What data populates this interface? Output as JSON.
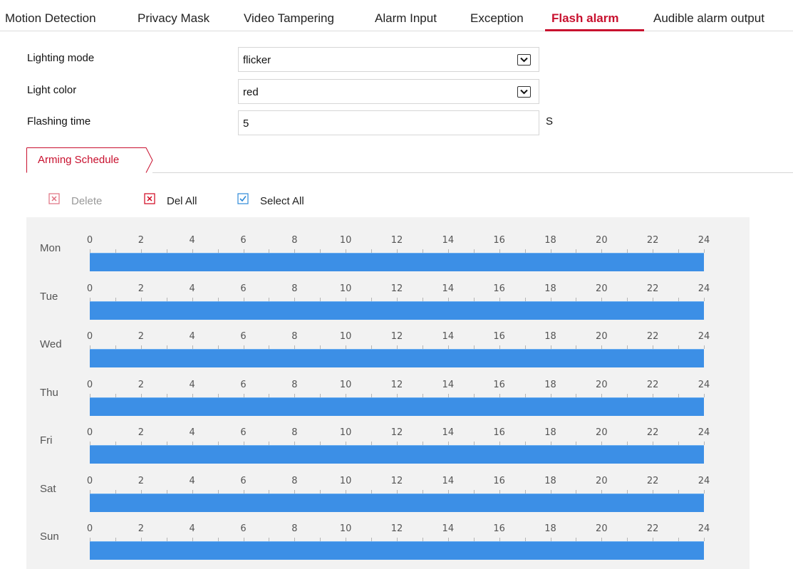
{
  "tabs": [
    {
      "label": "Motion Detection",
      "active": false
    },
    {
      "label": "Privacy Mask",
      "active": false
    },
    {
      "label": "Video Tampering",
      "active": false
    },
    {
      "label": "Alarm Input",
      "active": false
    },
    {
      "label": "Exception",
      "active": false
    },
    {
      "label": "Flash alarm",
      "active": true
    },
    {
      "label": "Audible alarm output",
      "active": false
    }
  ],
  "form": {
    "lighting_mode": {
      "label": "Lighting mode",
      "value": "flicker"
    },
    "light_color": {
      "label": "Light color",
      "value": "red"
    },
    "flashing_time": {
      "label": "Flashing time",
      "value": "5",
      "unit": "S"
    }
  },
  "schedule": {
    "tab_label": "Arming Schedule",
    "toolbar": {
      "delete_label": "Delete",
      "del_all_label": "Del All",
      "select_all_label": "Select All"
    },
    "days": [
      "Mon",
      "Tue",
      "Wed",
      "Thu",
      "Fri",
      "Sat",
      "Sun"
    ],
    "hour_labels": [
      "0",
      "2",
      "4",
      "6",
      "8",
      "10",
      "12",
      "14",
      "16",
      "18",
      "20",
      "22",
      "24"
    ],
    "armed_ranges": [
      {
        "day": "Mon",
        "start": 0,
        "end": 24
      },
      {
        "day": "Tue",
        "start": 0,
        "end": 24
      },
      {
        "day": "Wed",
        "start": 0,
        "end": 24
      },
      {
        "day": "Thu",
        "start": 0,
        "end": 24
      },
      {
        "day": "Fri",
        "start": 0,
        "end": 24
      },
      {
        "day": "Sat",
        "start": 0,
        "end": 24
      },
      {
        "day": "Sun",
        "start": 0,
        "end": 24
      }
    ]
  },
  "colors": {
    "accent": "#c8102e",
    "armed": "#3c8fe6",
    "checkbox_blue": "#2e8ad8",
    "delete_red": "#d0021b"
  }
}
